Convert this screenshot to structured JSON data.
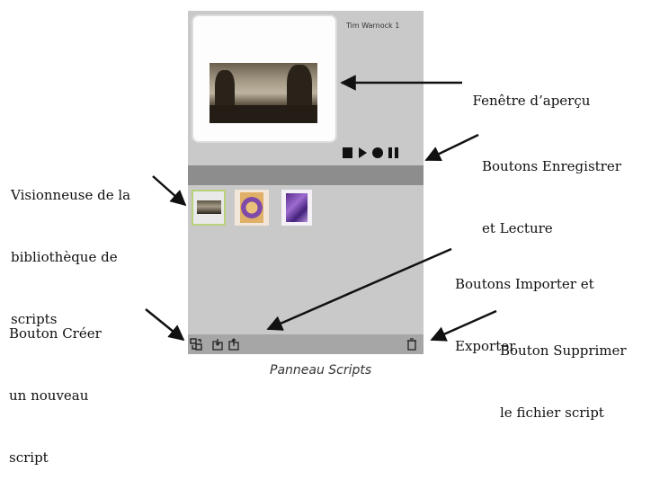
{
  "panel": {
    "user_name": "Tim Warnock 1",
    "transport_icons": [
      "stop-icon",
      "play-icon",
      "record-icon",
      "pause-icon"
    ],
    "footer_icons": [
      "create-script-icon",
      "import-icon",
      "export-icon",
      "delete-icon"
    ],
    "thumbnails": [
      "script-thumbnail-1",
      "script-thumbnail-2",
      "script-thumbnail-3"
    ],
    "selected_thumbnail_color": "#b7d27a"
  },
  "callouts": {
    "preview_window": "Fenêtre d’aperçu",
    "record_play_line1": "Boutons Enregistrer",
    "record_play_line2": "et Lecture",
    "library_viewer_line1": "Visionneuse de la",
    "library_viewer_line2": "bibliothèque de",
    "library_viewer_line3": "scripts",
    "import_export_line1": "Boutons Importer et",
    "import_export_line2": "Exporter",
    "create_line1": "Bouton Créer",
    "create_line2": "un nouveau",
    "create_line3": "script",
    "delete_line1": "Bouton Supprimer",
    "delete_line2": "le fichier script"
  },
  "caption": "Panneau Scripts"
}
